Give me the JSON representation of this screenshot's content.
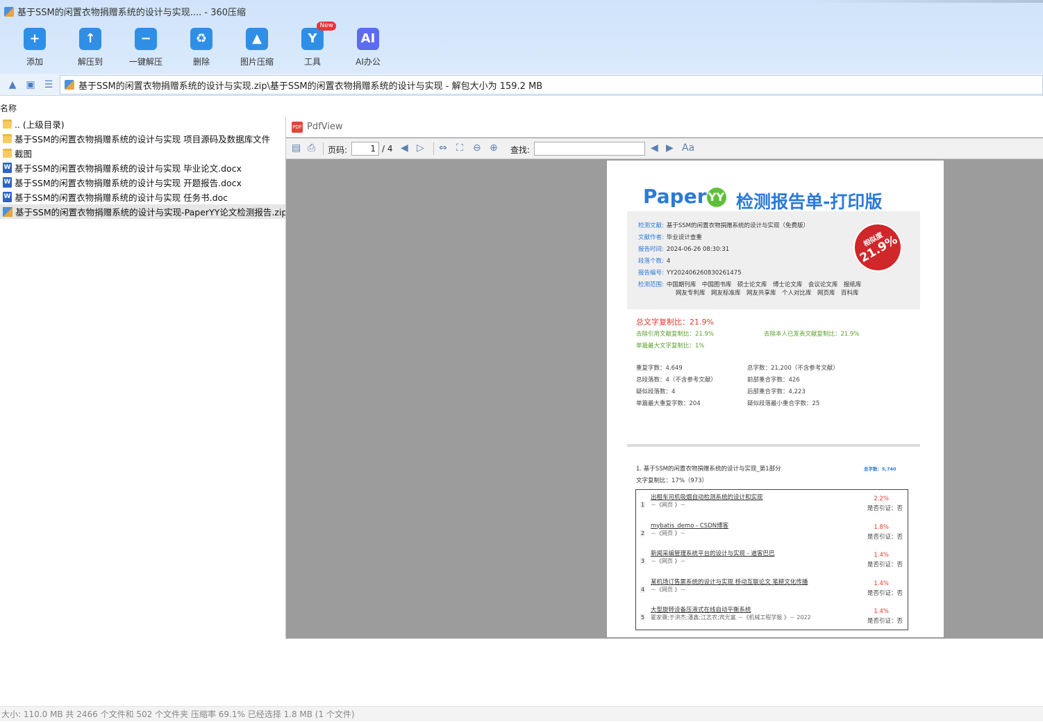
{
  "window": {
    "title": "基于SSM的闲置衣物捐赠系统的设计与实现.... - 360压缩"
  },
  "toolbar": [
    {
      "label": "添加",
      "icon": "add-icon",
      "glyph": "+",
      "color": "#2f8fe6"
    },
    {
      "label": "解压到",
      "icon": "extract-to-icon",
      "glyph": "↑",
      "color": "#2f8fe6"
    },
    {
      "label": "一键解压",
      "icon": "one-click-extract-icon",
      "glyph": "−",
      "color": "#2f8fe6"
    },
    {
      "label": "删除",
      "icon": "delete-icon",
      "glyph": "♻",
      "color": "#2f8fe6"
    },
    {
      "label": "图片压缩",
      "icon": "image-compress-icon",
      "glyph": "▲",
      "color": "#2f8fe6"
    },
    {
      "label": "工具",
      "icon": "tools-icon",
      "glyph": "Y",
      "color": "#2f8fe6",
      "badge": "New"
    },
    {
      "label": "AI办公",
      "icon": "ai-office-icon",
      "glyph": "AI",
      "color": "#5b6cf0"
    }
  ],
  "address": {
    "path": "基于SSM的闲置衣物捐赠系统的设计与实现.zip\\基于SSM的闲置衣物捐赠系统的设计与实现 - 解包大小为 159.2 MB"
  },
  "list_header": {
    "name": "名称"
  },
  "files": [
    {
      "name": ".. (上级目录)",
      "type": "folder"
    },
    {
      "name": "基于SSM的闲置衣物捐赠系统的设计与实现 项目源码及数据库文件",
      "type": "folder"
    },
    {
      "name": "截图",
      "type": "folder"
    },
    {
      "name": "基于SSM的闲置衣物捐赠系统的设计与实现 毕业论文.docx",
      "type": "word"
    },
    {
      "name": "基于SSM的闲置衣物捐赠系统的设计与实现 开题报告.docx",
      "type": "word"
    },
    {
      "name": "基于SSM的闲置衣物捐赠系统的设计与实现 任务书.doc",
      "type": "word"
    },
    {
      "name": "基于SSM的闲置衣物捐赠系统的设计与实现-PaperYY论文检测报告.zip",
      "type": "zip",
      "selected": true
    }
  ],
  "pdfview": {
    "title": "PdfView",
    "page_label": "页码:",
    "page_current": "1",
    "page_total": "/ 4",
    "find_label": "查找:",
    "find_value": ""
  },
  "report": {
    "logo": "Paper",
    "logo_mark": "YY",
    "heading": "检测报告单-打印版",
    "fields": [
      {
        "k": "检测文献:",
        "v": "基于SSM的闲置衣物捐赠系统的设计与实现（免费版）"
      },
      {
        "k": "文献作者:",
        "v": "毕业设计查重"
      },
      {
        "k": "报告时间:",
        "v": "2024-06-26 08:30:31"
      },
      {
        "k": "段落个数:",
        "v": "4"
      },
      {
        "k": "报告编号:",
        "v": "YY202406260830261475"
      },
      {
        "k": "检测范围:",
        "v": "中国期刊库　中国图书库　硕士论文库　博士论文库　会议论文库　报纸库"
      }
    ],
    "scope_line2": "网友专利库　网友标准库　网友共享库　个人对比库　网页库　百科库",
    "stamp_top": "相似度",
    "stamp_value": "21.9%",
    "total_ratio": "总文字复制比：21.9%",
    "exclude_ref": "去除引用文献复制比：21.9%",
    "exclude_self": "去除本人已发表文献复制比：21.9%",
    "single_max": "单篇最大文字复制比：1%",
    "stats_left": [
      "重复字数：4,649",
      "总段落数：4（不含参考文献）",
      "疑似段落数：4",
      "单篇最大重复字数：204"
    ],
    "stats_right": [
      "总字数：21,200（不含参考文献）",
      "前部重合字数：426",
      "后部重合字数：4,223",
      "疑似段落最小重合字数：25"
    ],
    "section_title": "1. 基于SSM的闲置衣物捐赠系统的设计与实现_第1部分",
    "section_total": "总字数：5,740",
    "section_ratio": "文字复制比：17%（973）",
    "sources": [
      {
        "n": "1",
        "title": "出租车司机吸烟自动检测系统的设计和实现",
        "sub": "－《网页 》－",
        "pct": "2.2%",
        "cite": "是否引证：否"
      },
      {
        "n": "2",
        "title": "mybatis_demo - CSDN博客",
        "sub": "－《网页 》－",
        "pct": "1.8%",
        "cite": "是否引证：否"
      },
      {
        "n": "3",
        "title": "新闻采编管理系统平台的设计与实现 - 道客巴巴",
        "sub": "－《网页 》－",
        "pct": "1.4%",
        "cite": "是否引证：否"
      },
      {
        "n": "4",
        "title": "某机场订售票系统的设计与实现 移动互联论文 笔耕文化传播",
        "sub": "－《网页 》－",
        "pct": "1.4%",
        "cite": "是否引证：否"
      },
      {
        "n": "5",
        "title": "大型旋转设备压液式在线自动平衡系统",
        "sub": "霍家骥;于洪杰;潘鑫;江志农;宾光富 －《机械工程学报 》－ 2022",
        "pct": "1.4%",
        "cite": "是否引证：否"
      }
    ]
  },
  "status": {
    "text": "大小: 110.0 MB 共 2466 个文件和 502 个文件夹 压缩率 69.1% 已经选择 1.8 MB (1 个文件)"
  }
}
